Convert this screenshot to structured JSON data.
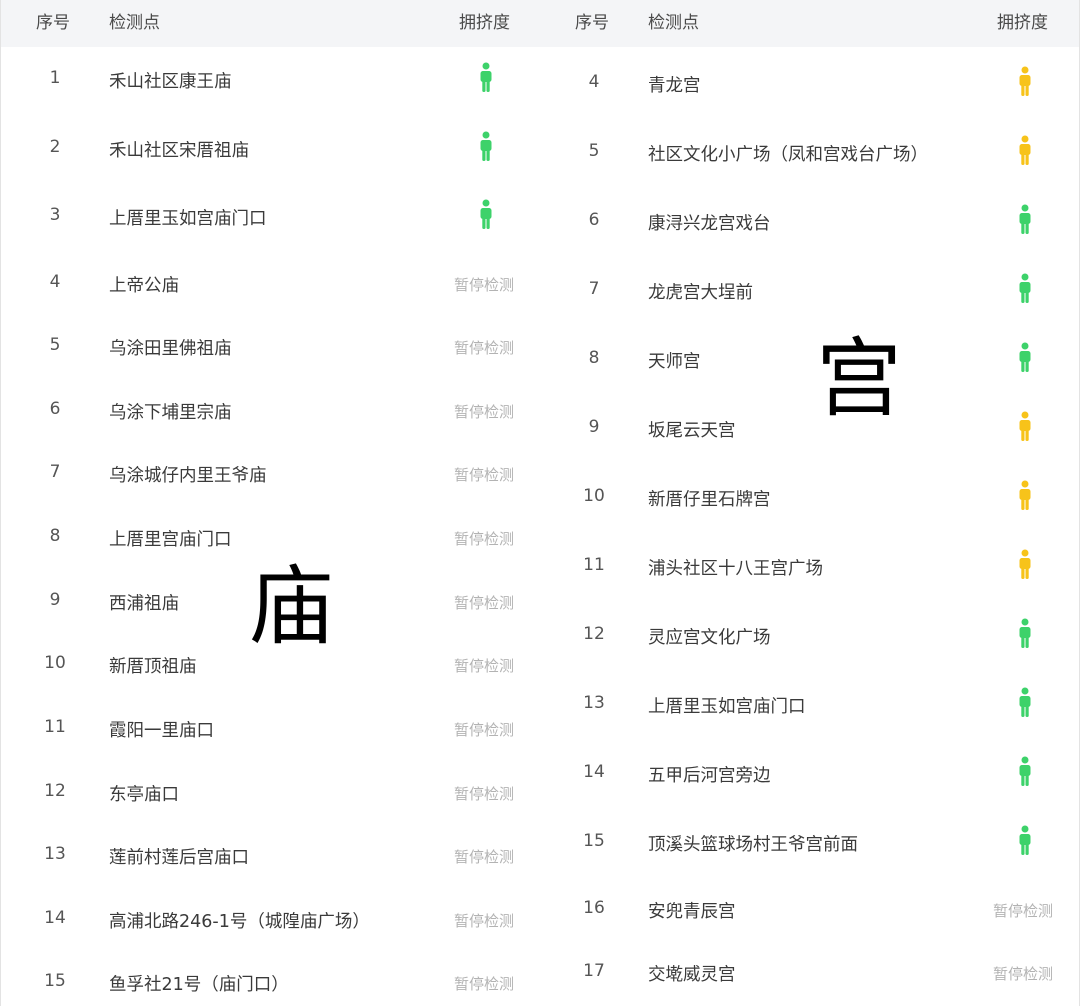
{
  "header": {
    "num": "序号",
    "location": "检测点",
    "crowd": "拥挤度"
  },
  "colors": {
    "green": "#3dd26a",
    "yellow": "#f7c31a",
    "paused": "#b3b3b3"
  },
  "icons": {
    "person": "person-icon"
  },
  "left": {
    "overlay_char": "庙",
    "rows": [
      {
        "num": "1",
        "name": "禾山社区康王庙",
        "status": "green"
      },
      {
        "num": "2",
        "name": "禾山社区宋厝祖庙",
        "status": "green"
      },
      {
        "num": "3",
        "name": "上厝里玉如宫庙门口",
        "status": "green"
      },
      {
        "num": "4",
        "name": "上帝公庙",
        "status": "paused",
        "status_text": "暂停检测"
      },
      {
        "num": "5",
        "name": "乌涂田里佛祖庙",
        "status": "paused",
        "status_text": "暂停检测"
      },
      {
        "num": "6",
        "name": "乌涂下埔里宗庙",
        "status": "paused",
        "status_text": "暂停检测"
      },
      {
        "num": "7",
        "name": "乌涂城仔内里王爷庙",
        "status": "paused",
        "status_text": "暂停检测"
      },
      {
        "num": "8",
        "name": "上厝里宫庙门口",
        "status": "paused",
        "status_text": "暂停检测"
      },
      {
        "num": "9",
        "name": "西浦祖庙",
        "status": "paused",
        "status_text": "暂停检测"
      },
      {
        "num": "10",
        "name": "新厝顶祖庙",
        "status": "paused",
        "status_text": "暂停检测"
      },
      {
        "num": "11",
        "name": "霞阳一里庙口",
        "status": "paused",
        "status_text": "暂停检测"
      },
      {
        "num": "12",
        "name": "东亭庙口",
        "status": "paused",
        "status_text": "暂停检测"
      },
      {
        "num": "13",
        "name": "莲前村莲后宫庙口",
        "status": "paused",
        "status_text": "暂停检测"
      },
      {
        "num": "14",
        "name": "高浦北路246-1号（城隍庙广场）",
        "status": "paused",
        "status_text": "暂停检测"
      },
      {
        "num": "15",
        "name": "鱼孚社21号（庙门口）",
        "status": "paused",
        "status_text": "暂停检测"
      }
    ]
  },
  "right": {
    "overlay_char": "宫",
    "rows": [
      {
        "num": "4",
        "name": "青龙宫",
        "status": "yellow"
      },
      {
        "num": "5",
        "name": "社区文化小广场（凤和宫戏台广场）",
        "status": "yellow"
      },
      {
        "num": "6",
        "name": "康浔兴龙宫戏台",
        "status": "green"
      },
      {
        "num": "7",
        "name": "龙虎宫大埕前",
        "status": "green"
      },
      {
        "num": "8",
        "name": "天师宫",
        "status": "green"
      },
      {
        "num": "9",
        "name": "坂尾云天宫",
        "status": "yellow"
      },
      {
        "num": "10",
        "name": "新厝仔里石牌宫",
        "status": "yellow"
      },
      {
        "num": "11",
        "name": "浦头社区十八王宫广场",
        "status": "yellow"
      },
      {
        "num": "12",
        "name": "灵应宫文化广场",
        "status": "green"
      },
      {
        "num": "13",
        "name": "上厝里玉如宫庙门口",
        "status": "green"
      },
      {
        "num": "14",
        "name": "五甲后河宫旁边",
        "status": "green"
      },
      {
        "num": "15",
        "name": "顶溪头篮球场村王爷宫前面",
        "status": "green"
      },
      {
        "num": "16",
        "name": "安兜青辰宫",
        "status": "paused",
        "status_text": "暂停检测"
      },
      {
        "num": "17",
        "name": "交墘威灵宫",
        "status": "paused",
        "status_text": "暂停检测"
      }
    ]
  }
}
